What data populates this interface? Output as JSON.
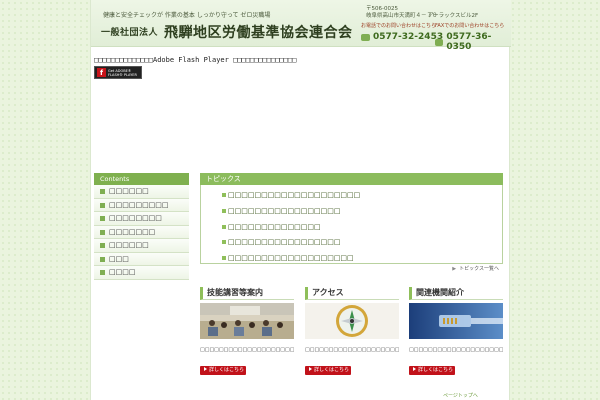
{
  "header": {
    "tagline": "健康と安全チェックが 作業の基本 しっかり守って ゼロ災職場",
    "org_prefix": "一般社団法人",
    "org_name": "飛騨地区労働基準協会連合会",
    "postal": "〒506-0025",
    "address": "岐阜県高山市天満町４－７０",
    "building": "アーラックスビル2F",
    "phone_label": "お電話でのお問い合わせはこちら",
    "fax_label": "FAXでのお問い合わせはこちら",
    "phone": "0577-32-2453",
    "fax": "0577-36-0350"
  },
  "flash": {
    "message": "□□□□□□□□□□□□□□Adobe Flash Player □□□□□□□□□□□□□□□",
    "badge_get": "Get ADOBE®",
    "badge_name": "FLASH® PLAYER"
  },
  "sidebar": {
    "heading": "Contents",
    "items": [
      {
        "label": "□□□□□□"
      },
      {
        "label": "□□□□□□□□□"
      },
      {
        "label": "□□□□□□□□"
      },
      {
        "label": "□□□□□□□"
      },
      {
        "label": "□□□□□□"
      },
      {
        "label": "□□□"
      },
      {
        "label": "□□□□"
      }
    ]
  },
  "topics": {
    "heading": "トピックス",
    "items": [
      {
        "label": "□□□□□□□□□□□□□□□□□□□□"
      },
      {
        "label": "□□□□□□□□□□□□□□□□□"
      },
      {
        "label": "□□□□□□□□□□□□□□"
      },
      {
        "label": "□□□□□□□□□□□□□□□□□"
      },
      {
        "label": "□□□□□□□□□□□□□□□□□□□"
      }
    ],
    "more": "トピックス一覧へ"
  },
  "cards": [
    {
      "title": "技能講習等案内",
      "text": "□□□□□□□□□□□□□□□□□□□□□□□□□□□□□",
      "button": "詳しくはこちら",
      "image": "seminar-room"
    },
    {
      "title": "アクセス",
      "text": "□□□□□□□□□□□□□□□□□□□□□□□□□□□□□",
      "button": "詳しくはこちら",
      "image": "compass"
    },
    {
      "title": "関連機関紹介",
      "text": "□□□□□□□□□□□□□□□□□□□□□□□□□□□□□",
      "button": "詳しくはこちら",
      "image": "network-cable"
    }
  ],
  "pagetop": "ページトップへ",
  "colors": {
    "accent_green": "#8cbc5d",
    "button_red": "#c1121a",
    "page_bg": "#eaf4de"
  }
}
